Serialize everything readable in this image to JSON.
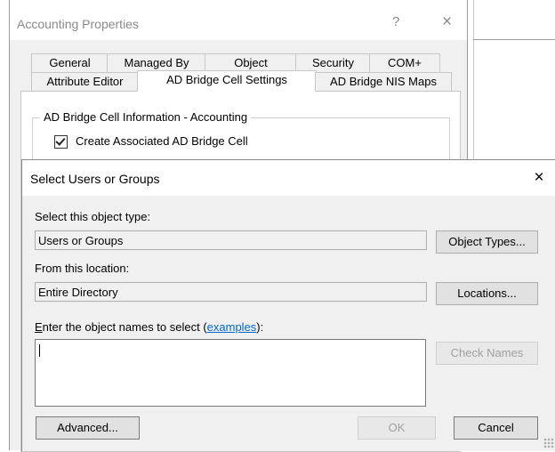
{
  "parent_window": {
    "title": "Accounting Properties",
    "help_glyph": "?",
    "close_glyph": "×",
    "tabs_row1": [
      "General",
      "Managed By",
      "Object",
      "Security",
      "COM+"
    ],
    "tabs_row2": [
      "Attribute Editor",
      "AD Bridge Cell Settings",
      "AD Bridge NIS Maps"
    ],
    "active_tab": "AD Bridge Cell Settings",
    "group_title": "AD Bridge Cell Information - Accounting",
    "checkbox_label": "Create Associated AD Bridge Cell",
    "checkbox_checked": true
  },
  "dialog": {
    "title": "Select Users or Groups",
    "close_glyph": "×",
    "object_type_label": "Select this object type:",
    "object_type_value": "Users or Groups",
    "object_types_button": "Object Types...",
    "location_label": "From this location:",
    "location_value": "Entire Directory",
    "locations_button": "Locations...",
    "names_label_mnemonic": "E",
    "names_label_rest": "nter the object names to select (",
    "names_label_link": "examples",
    "names_label_end": "):",
    "names_value": "",
    "check_names_button": "Check Names",
    "advanced_button": "Advanced...",
    "ok_button": "OK",
    "cancel_button": "Cancel"
  }
}
